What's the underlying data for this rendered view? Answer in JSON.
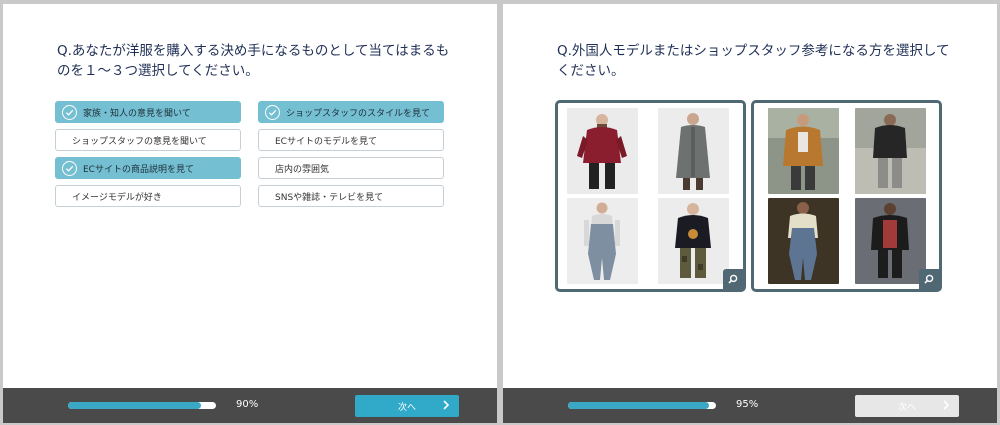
{
  "left": {
    "question": "Q.あなたが洋服を購入する決め手になるものとして当てはまるものを１〜３つ選択してください。",
    "options": [
      {
        "label": "家族・知人の意見を聞いて",
        "selected": true
      },
      {
        "label": "ショップスタッフのスタイルを見て",
        "selected": true
      },
      {
        "label": "ショップスタッフの意見を聞いて",
        "selected": false
      },
      {
        "label": "ECサイトのモデルを見て",
        "selected": false
      },
      {
        "label": "ECサイトの商品説明を見て",
        "selected": true
      },
      {
        "label": "店内の雰囲気",
        "selected": false
      },
      {
        "label": "イメージモデルが好き",
        "selected": false
      },
      {
        "label": "SNSや雑誌・テレビを見て",
        "selected": false
      }
    ],
    "progress": {
      "value": 90,
      "label": "90%"
    },
    "next_label": "次へ",
    "next_enabled": true
  },
  "right": {
    "question": "Q.外国人モデルまたはショップスタッフ参考になる方を選択してください。",
    "progress": {
      "value": 95,
      "label": "95%"
    },
    "next_label": "次へ",
    "next_enabled": false
  },
  "colors": {
    "accent": "#31a9c9",
    "selected_option": "#74bfd1",
    "card_border": "#4f6874",
    "bar_bg": "#4a4a4a",
    "text": "#1f2f55"
  },
  "icons": {
    "check": "check-circle-icon",
    "next": "chevron-right-icon",
    "zoom": "search-icon"
  }
}
